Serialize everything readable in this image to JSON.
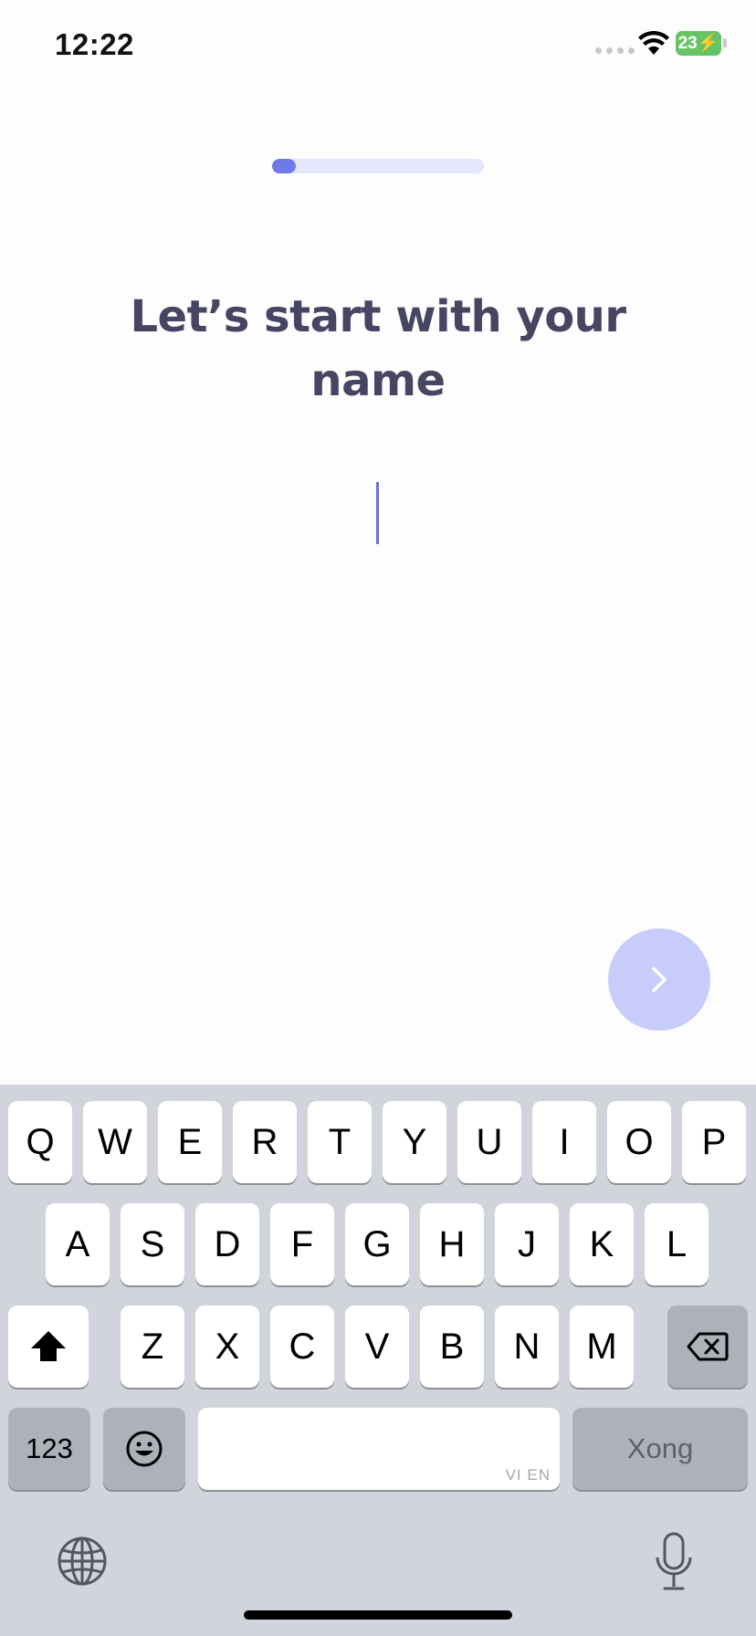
{
  "status_bar": {
    "time": "12:22",
    "battery": "23"
  },
  "onboarding": {
    "progress_percent": 11
  },
  "title": {
    "line1": "Let’s start with your",
    "line2": "name"
  },
  "name_input": {
    "value": "",
    "placeholder": ""
  },
  "next_button": {
    "icon": "chevron-right-icon",
    "color": "#c8ccfb"
  },
  "keyboard": {
    "row1": [
      "Q",
      "W",
      "E",
      "R",
      "T",
      "Y",
      "U",
      "I",
      "O",
      "P"
    ],
    "row2": [
      "A",
      "S",
      "D",
      "F",
      "G",
      "H",
      "J",
      "K",
      "L"
    ],
    "row3": [
      "Z",
      "X",
      "C",
      "V",
      "B",
      "N",
      "M"
    ],
    "numbers_label": "123",
    "space_lang": "VI EN",
    "done_label": "Xong"
  },
  "colors": {
    "accent": "#7079e8",
    "title": "#464562",
    "keyboard_bg": "#d2d4db"
  }
}
